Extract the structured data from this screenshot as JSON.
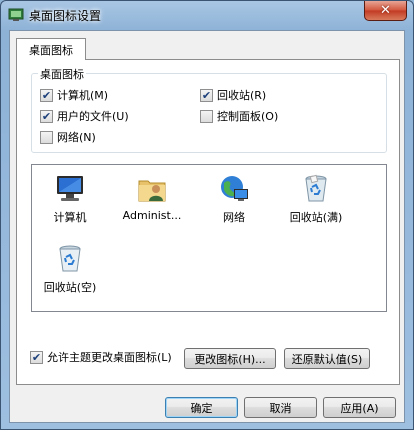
{
  "window": {
    "title": "桌面图标设置",
    "close_glyph": "✕"
  },
  "tabs": [
    {
      "label": "桌面图标"
    }
  ],
  "group": {
    "legend": "桌面图标",
    "checkboxes": [
      {
        "label": "计算机(M)",
        "checked": true
      },
      {
        "label": "回收站(R)",
        "checked": true
      },
      {
        "label": "用户的文件(U)",
        "checked": true
      },
      {
        "label": "控制面板(O)",
        "checked": false
      },
      {
        "label": "网络(N)",
        "checked": false
      }
    ]
  },
  "icons": [
    {
      "label": "计算机",
      "icon": "computer-icon"
    },
    {
      "label": "Administ...",
      "icon": "user-folder-icon"
    },
    {
      "label": "网络",
      "icon": "network-icon"
    },
    {
      "label": "回收站(满)",
      "icon": "recycle-bin-full-icon"
    },
    {
      "label": "回收站(空)",
      "icon": "recycle-bin-empty-icon"
    }
  ],
  "buttons": {
    "change_icon": "更改图标(H)...",
    "restore_default": "还原默认值(S)",
    "ok": "确定",
    "cancel": "取消",
    "apply": "应用(A)"
  },
  "theme_option": {
    "label": "允许主题更改桌面图标(L)",
    "checked": true
  },
  "check_glyph": "✔"
}
